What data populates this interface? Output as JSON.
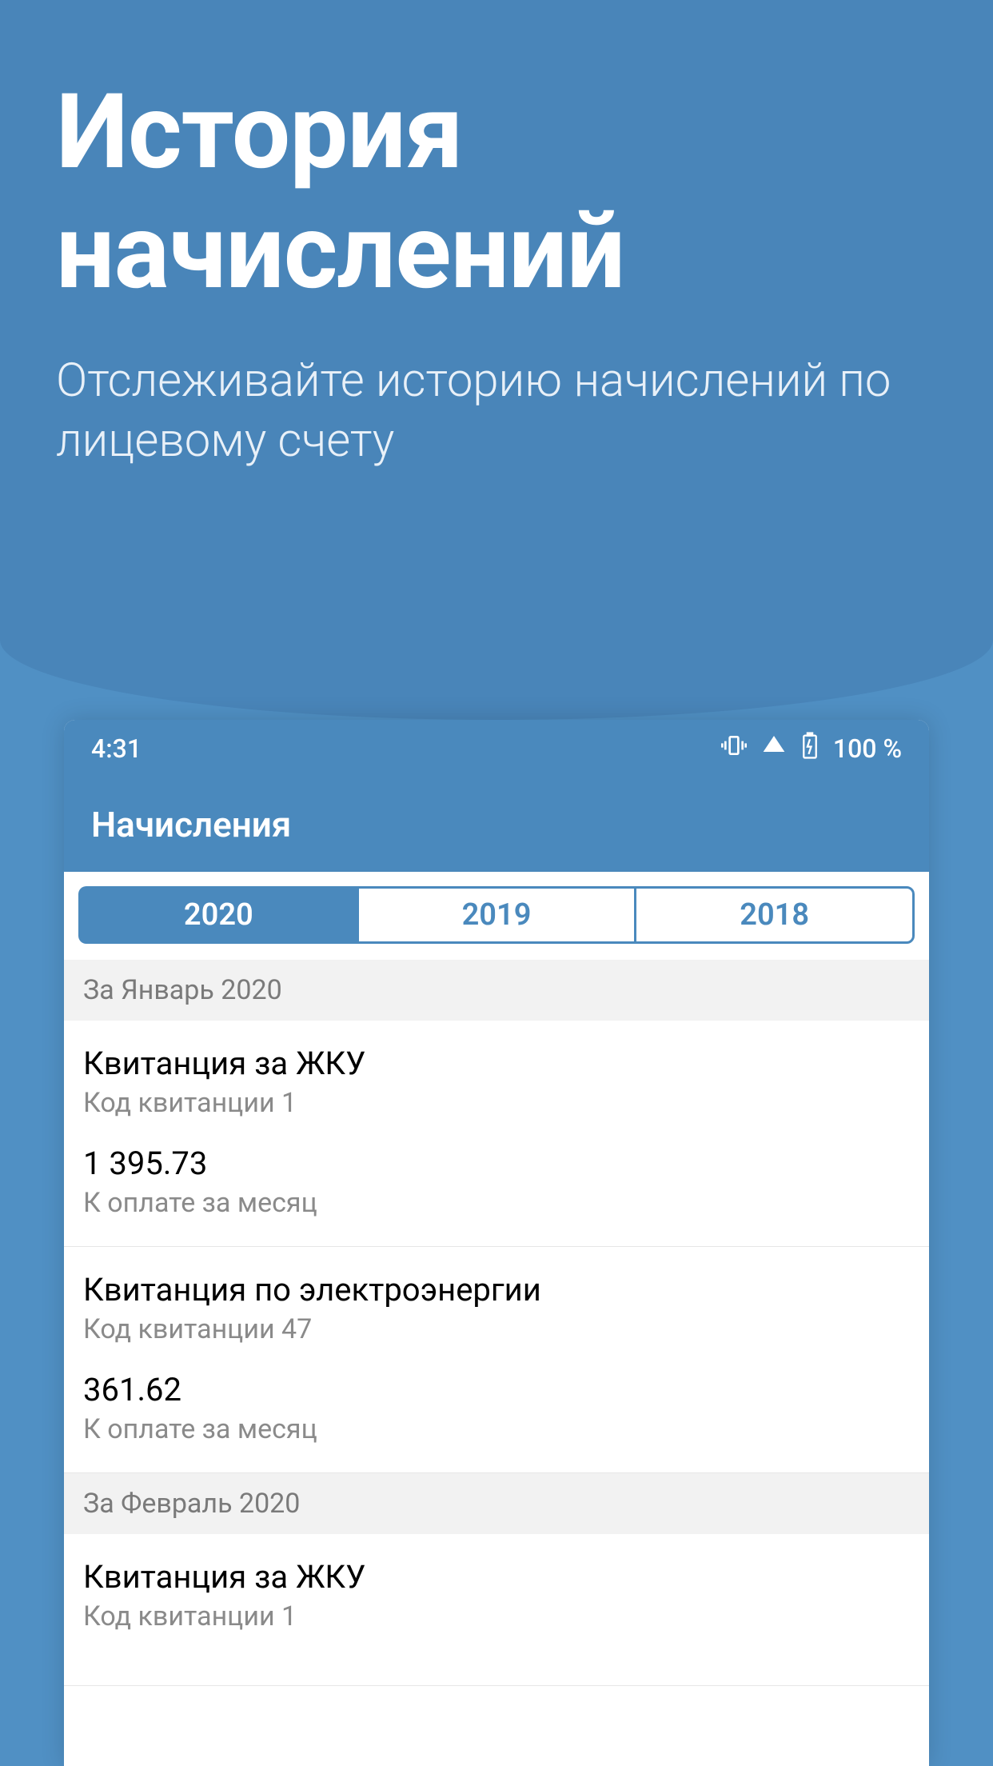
{
  "marketing": {
    "title_line1": "История",
    "title_line2": "начислений",
    "subtitle": "Отслеживайте историю начислений по лицевому счету"
  },
  "status_bar": {
    "time": "4:31",
    "battery": "100 %"
  },
  "app_header": {
    "title": "Начисления"
  },
  "tabs": [
    {
      "label": "2020",
      "active": true
    },
    {
      "label": "2019",
      "active": false
    },
    {
      "label": "2018",
      "active": false
    }
  ],
  "sections": [
    {
      "header": "За Январь 2020",
      "invoices": [
        {
          "title": "Квитанция за ЖКУ",
          "code": "Код квитанции 1",
          "amount": "1 395.73",
          "note": "К оплате за месяц"
        },
        {
          "title": "Квитанция по электроэнергии",
          "code": "Код квитанции 47",
          "amount": "361.62",
          "note": "К оплате за месяц"
        }
      ]
    },
    {
      "header": "За Февраль 2020",
      "invoices": [
        {
          "title": "Квитанция за ЖКУ",
          "code": "Код квитанции 1",
          "amount": "",
          "note": ""
        }
      ]
    }
  ]
}
